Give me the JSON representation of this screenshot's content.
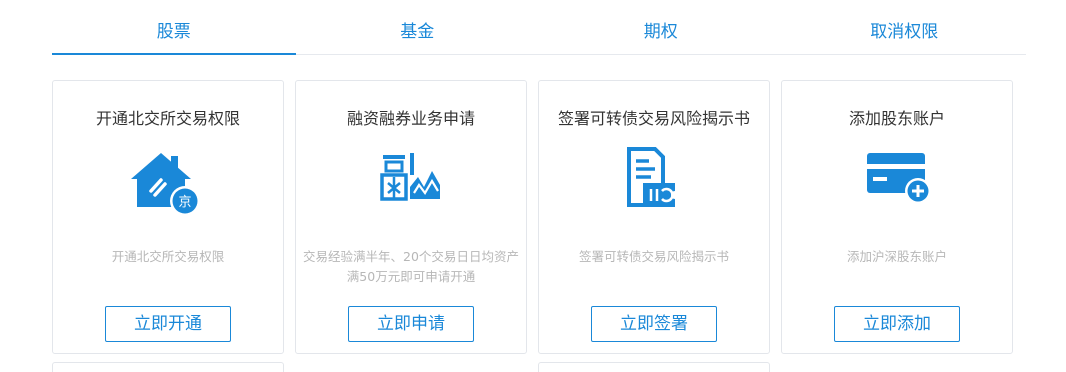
{
  "tabs": [
    {
      "label": "股票",
      "active": true
    },
    {
      "label": "基金",
      "active": false
    },
    {
      "label": "期权",
      "active": false
    },
    {
      "label": "取消权限",
      "active": false
    }
  ],
  "cards": [
    {
      "title": "开通北交所交易权限",
      "icon": "house-jing-icon",
      "badge": "京",
      "desc": "开通北交所交易权限",
      "button": "立即开通"
    },
    {
      "title": "融资融券业务申请",
      "icon": "rong-chart-icon",
      "badge": "",
      "desc": "交易经验满半年、20个交易日日均资产满50万元即可申请开通",
      "button": "立即申请"
    },
    {
      "title": "签署可转债交易风险揭示书",
      "icon": "document-convert-icon",
      "badge": "",
      "desc": "签署可转债交易风险揭示书",
      "button": "立即签署"
    },
    {
      "title": "添加股东账户",
      "icon": "card-add-icon",
      "badge": "",
      "desc": "添加沪深股东账户",
      "button": "立即添加"
    }
  ],
  "colors": {
    "accent": "#1a88d8",
    "border": "#e3e6eb",
    "muted": "#b7b7b7"
  }
}
